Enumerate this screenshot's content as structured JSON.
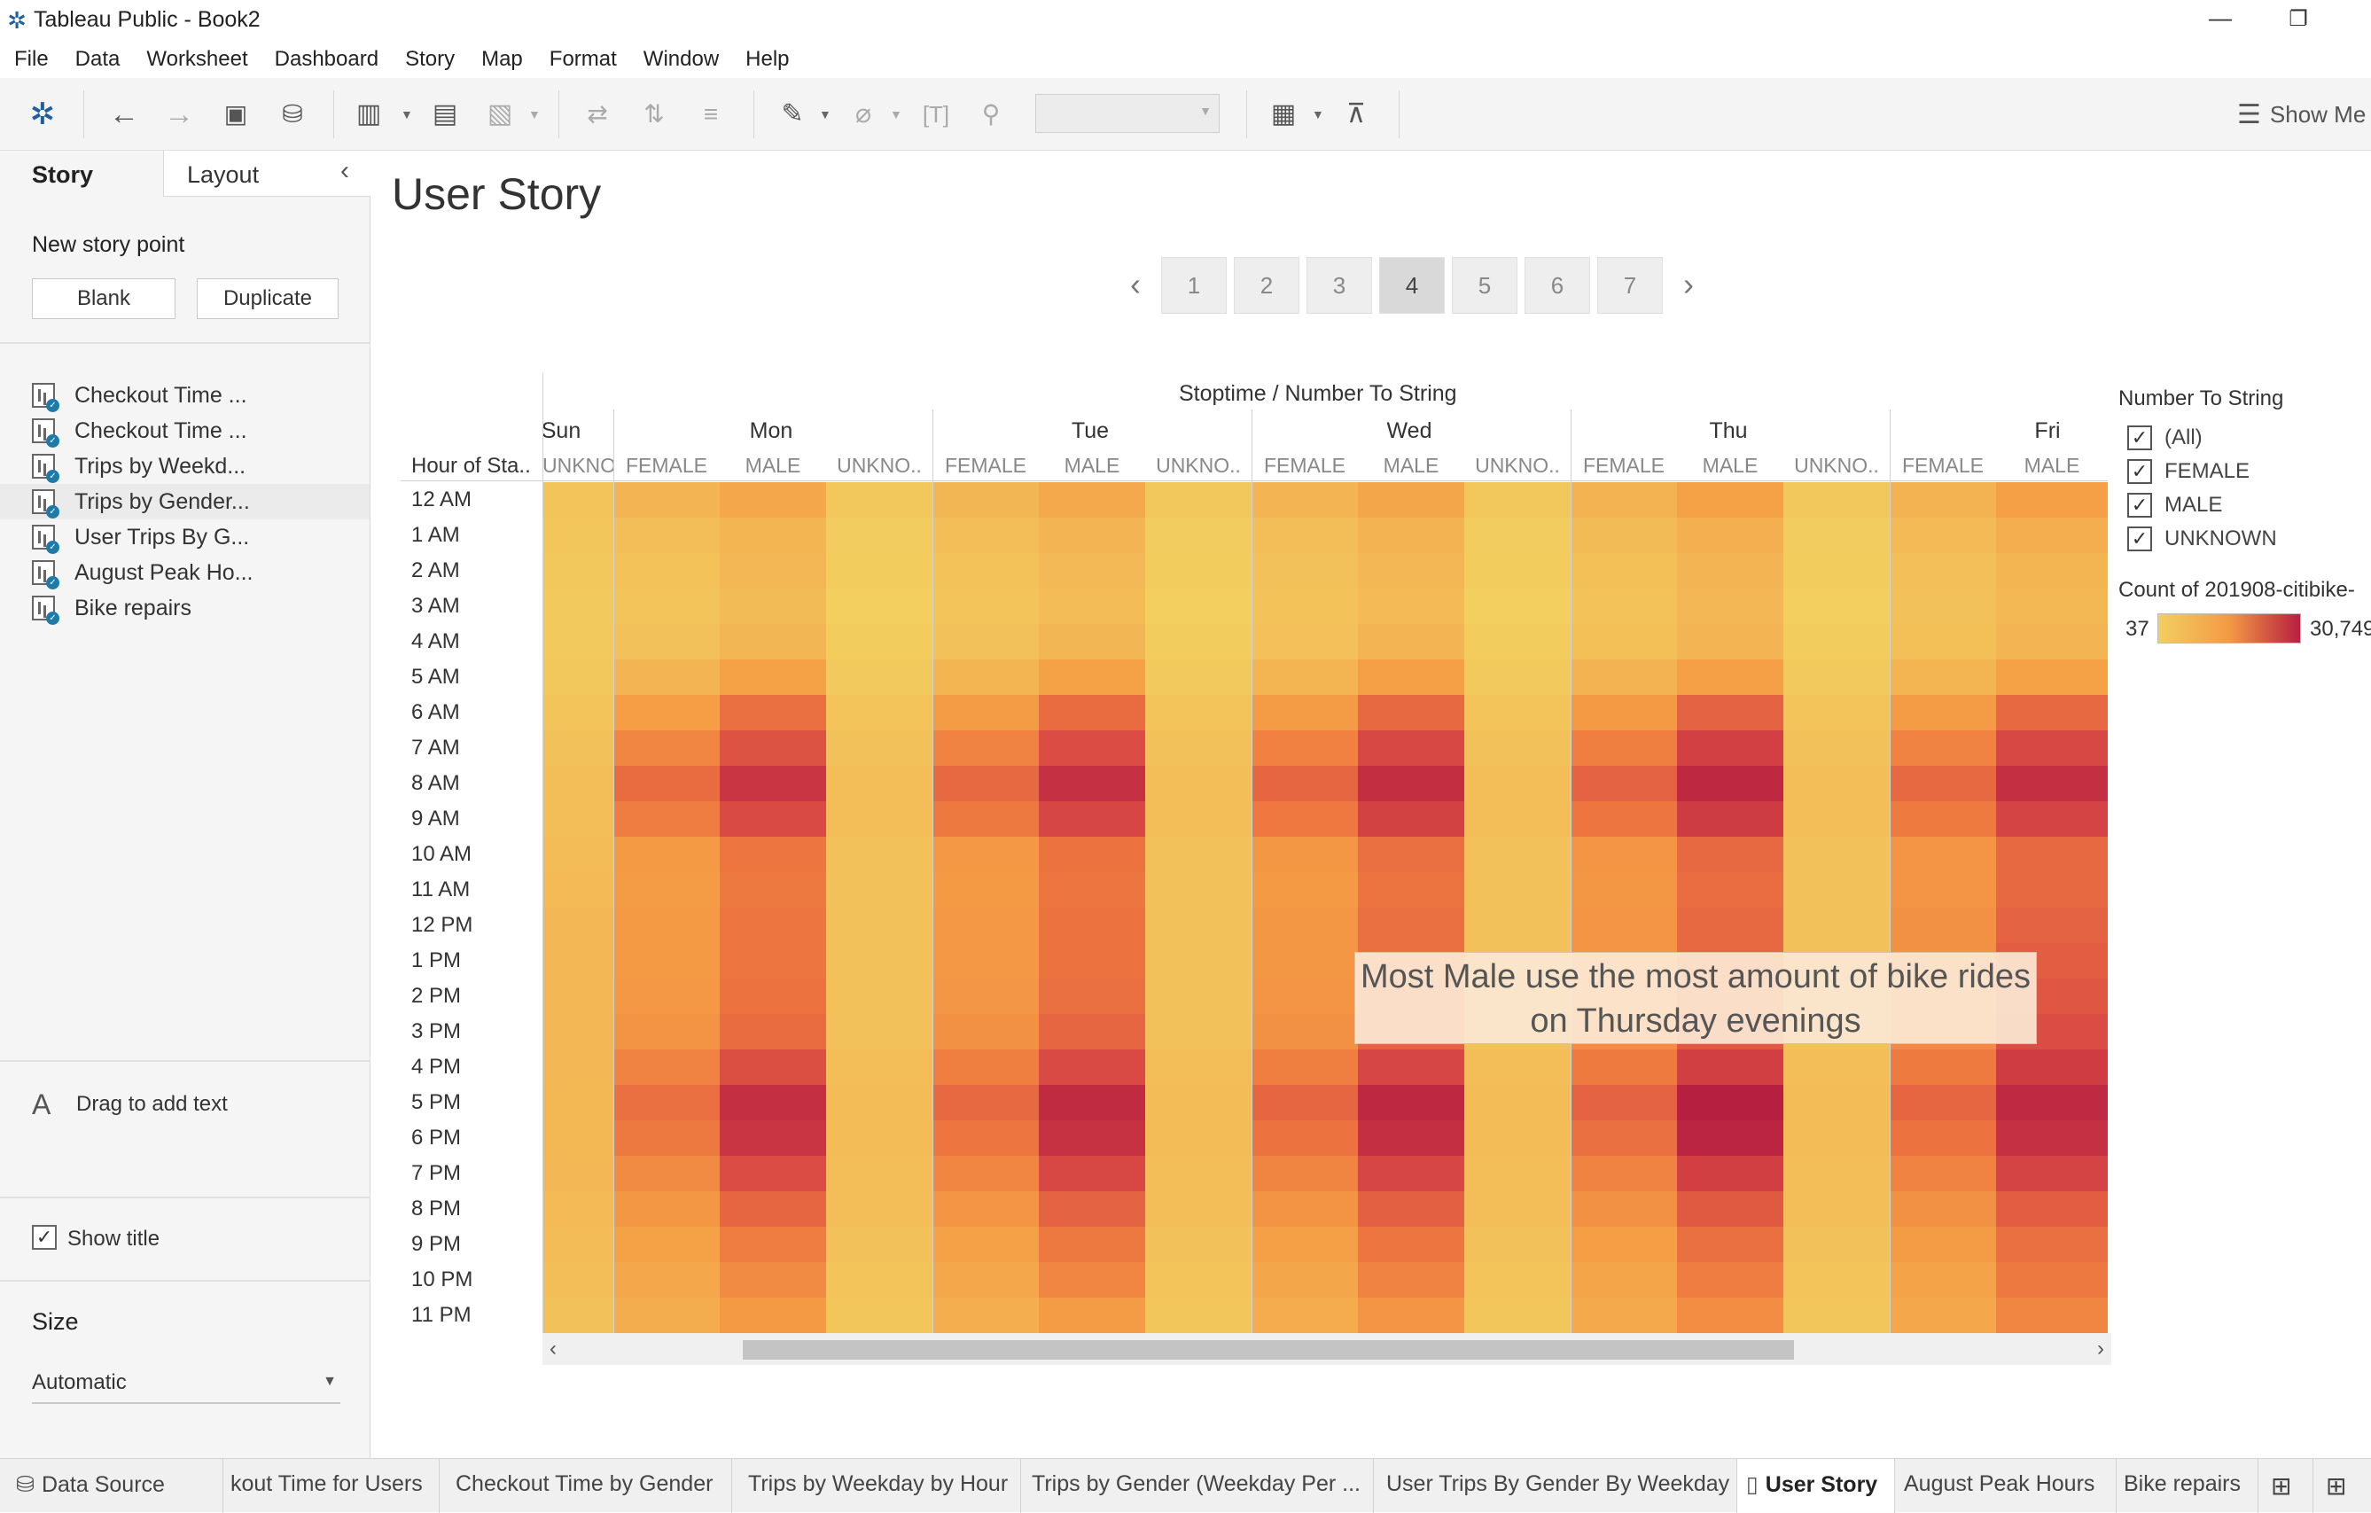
{
  "window": {
    "title": "Tableau Public - Book2"
  },
  "menu": [
    "File",
    "Data",
    "Worksheet",
    "Dashboard",
    "Story",
    "Map",
    "Format",
    "Window",
    "Help"
  ],
  "toolbar": {
    "show_me": "Show Me"
  },
  "left_panel": {
    "tabs": {
      "story": "Story",
      "layout": "Layout"
    },
    "new_story_point": "New story point",
    "blank": "Blank",
    "duplicate": "Duplicate",
    "sheets": [
      "Checkout Time ...",
      "Checkout Time ...",
      "Trips by Weekd...",
      "Trips by Gender...",
      "User Trips By G...",
      "August Peak Ho...",
      "Bike repairs"
    ],
    "drag_text": "Drag to add text",
    "show_title": "Show title",
    "size_label": "Size",
    "size_value": "Automatic"
  },
  "story": {
    "title": "User Story",
    "points": [
      "1",
      "2",
      "3",
      "4",
      "5",
      "6",
      "7"
    ],
    "active_point": "4"
  },
  "viz": {
    "column_header": "Stoptime  /  Number To String",
    "row_header": "Hour of Sta..",
    "days": [
      "Sun",
      "Mon",
      "Tue",
      "Wed",
      "Thu",
      "Fri"
    ],
    "column_labels": [
      "UNKNO..",
      "FEMALE",
      "MALE",
      "UNKNO..",
      "FEMALE",
      "MALE",
      "UNKNO..",
      "FEMALE",
      "MALE",
      "UNKNO..",
      "FEMALE",
      "MALE",
      "UNKNO..",
      "FEMALE",
      "MALE"
    ],
    "hours": [
      "12 AM",
      "1 AM",
      "2 AM",
      "3 AM",
      "4 AM",
      "5 AM",
      "6 AM",
      "7 AM",
      "8 AM",
      "9 AM",
      "10 AM",
      "11 AM",
      "12 PM",
      "1 PM",
      "2 PM",
      "3 PM",
      "4 PM",
      "5 PM",
      "6 PM",
      "7 PM",
      "8 PM",
      "9 PM",
      "10 PM",
      "11 PM"
    ],
    "annotation": "Most Male use the most amount of bike rides on Thursday evenings"
  },
  "legend": {
    "filter_title": "Number To String",
    "filter_items": [
      "(All)",
      "FEMALE",
      "MALE",
      "UNKNOWN"
    ],
    "color_title": "Count of 201908-citibike-",
    "min": "37",
    "max": "30,749",
    "colors": {
      "low": "#f2cf5f",
      "mid": "#f39a45",
      "high": "#b71f40"
    }
  },
  "chart_data": {
    "type": "heatmap",
    "title": "",
    "xlabel": "Stoptime  /  Number To String",
    "ylabel": "Hour of Sta..",
    "columns": [
      "Sun UNKNO..",
      "Mon FEMALE",
      "Mon MALE",
      "Mon UNKNO..",
      "Tue FEMALE",
      "Tue MALE",
      "Tue UNKNO..",
      "Wed FEMALE",
      "Wed MALE",
      "Wed UNKNO..",
      "Thu FEMALE",
      "Thu MALE",
      "Thu UNKNO..",
      "Fri FEMALE",
      "Fri MALE"
    ],
    "rows": [
      "12 AM",
      "1 AM",
      "2 AM",
      "3 AM",
      "4 AM",
      "5 AM",
      "6 AM",
      "7 AM",
      "8 AM",
      "9 AM",
      "10 AM",
      "11 AM",
      "12 PM",
      "1 PM",
      "2 PM",
      "3 PM",
      "4 PM",
      "5 PM",
      "6 PM",
      "7 PM",
      "8 PM",
      "9 PM",
      "10 PM",
      "11 PM"
    ],
    "color_range": [
      37,
      30749
    ],
    "values": [
      [
        200,
        1000,
        2500,
        100,
        900,
        2300,
        100,
        1000,
        2800,
        100,
        1200,
        3500,
        100,
        1200,
        3800
      ],
      [
        150,
        400,
        1100,
        50,
        400,
        1000,
        50,
        450,
        1200,
        50,
        550,
        1500,
        50,
        600,
        1700
      ],
      [
        100,
        250,
        700,
        40,
        250,
        650,
        40,
        280,
        750,
        40,
        330,
        950,
        40,
        380,
        1100
      ],
      [
        80,
        200,
        550,
        37,
        200,
        500,
        37,
        220,
        600,
        37,
        260,
        700,
        37,
        300,
        800
      ],
      [
        80,
        300,
        900,
        40,
        300,
        900,
        40,
        320,
        950,
        40,
        350,
        1000,
        40,
        350,
        1000
      ],
      [
        100,
        1000,
        3500,
        80,
        1100,
        3700,
        80,
        1100,
        3800,
        80,
        1150,
        3900,
        80,
        1100,
        3700
      ],
      [
        200,
        4000,
        10500,
        200,
        4200,
        11000,
        200,
        4300,
        11500,
        200,
        4500,
        12500,
        200,
        4200,
        11500
      ],
      [
        300,
        7000,
        15500,
        300,
        7500,
        16500,
        300,
        7800,
        17500,
        300,
        8000,
        19500,
        300,
        7500,
        17500
      ],
      [
        400,
        11000,
        23000,
        400,
        11500,
        24500,
        400,
        12000,
        25500,
        400,
        12500,
        27500,
        400,
        11500,
        25000
      ],
      [
        400,
        8500,
        17000,
        400,
        9000,
        18000,
        400,
        9200,
        19000,
        400,
        9500,
        21000,
        400,
        8800,
        18500
      ],
      [
        500,
        4500,
        9500,
        300,
        4700,
        10000,
        300,
        4800,
        10500,
        300,
        5000,
        11500,
        300,
        5000,
        11500
      ],
      [
        600,
        4300,
        9000,
        300,
        4500,
        9500,
        300,
        4500,
        9800,
        300,
        4800,
        10800,
        300,
        5000,
        11500
      ],
      [
        700,
        4500,
        9500,
        300,
        4700,
        10000,
        300,
        4800,
        10500,
        300,
        5000,
        11500,
        300,
        5500,
        12500
      ],
      [
        700,
        4500,
        9500,
        300,
        4700,
        10000,
        300,
        4800,
        10500,
        300,
        5000,
        11500,
        300,
        5500,
        13500
      ],
      [
        700,
        4700,
        10000,
        300,
        4900,
        10500,
        300,
        5000,
        11000,
        300,
        5300,
        12500,
        300,
        6000,
        14500
      ],
      [
        700,
        5300,
        11000,
        300,
        5500,
        12000,
        300,
        5600,
        12500,
        300,
        6000,
        14000,
        300,
        6500,
        16500
      ],
      [
        700,
        7500,
        16000,
        400,
        8000,
        17000,
        400,
        8200,
        18000,
        400,
        8800,
        20000,
        400,
        8800,
        20500
      ],
      [
        800,
        10500,
        25000,
        500,
        11500,
        26500,
        500,
        12000,
        27500,
        500,
        12500,
        30749,
        500,
        12000,
        27000
      ],
      [
        800,
        9000,
        23000,
        500,
        9500,
        24000,
        500,
        10000,
        25000,
        500,
        10500,
        28500,
        500,
        10000,
        24500
      ],
      [
        700,
        6500,
        16500,
        400,
        7000,
        17500,
        400,
        7200,
        18000,
        400,
        7500,
        20000,
        400,
        7500,
        18500
      ],
      [
        600,
        4800,
        12000,
        400,
        5000,
        12500,
        400,
        5200,
        13000,
        400,
        5500,
        14000,
        400,
        5500,
        13500
      ],
      [
        500,
        3500,
        8500,
        300,
        3600,
        9000,
        300,
        3800,
        9500,
        300,
        4000,
        10500,
        300,
        4200,
        10500
      ],
      [
        400,
        2500,
        6500,
        200,
        2600,
        7000,
        200,
        2700,
        7500,
        200,
        3000,
        8500,
        200,
        3300,
        9000
      ],
      [
        300,
        1800,
        4500,
        150,
        1700,
        4300,
        150,
        1900,
        5000,
        150,
        2200,
        6000,
        150,
        2600,
        7000
      ]
    ]
  },
  "bottom_tabs": [
    "Data Source",
    "kout Time for Users",
    "Checkout Time by Gender",
    "Trips by Weekday by Hour",
    "Trips by Gender (Weekday Per ...",
    "User Trips By Gender By Weekday",
    "User Story",
    "August Peak Hours",
    "Bike repairs"
  ]
}
